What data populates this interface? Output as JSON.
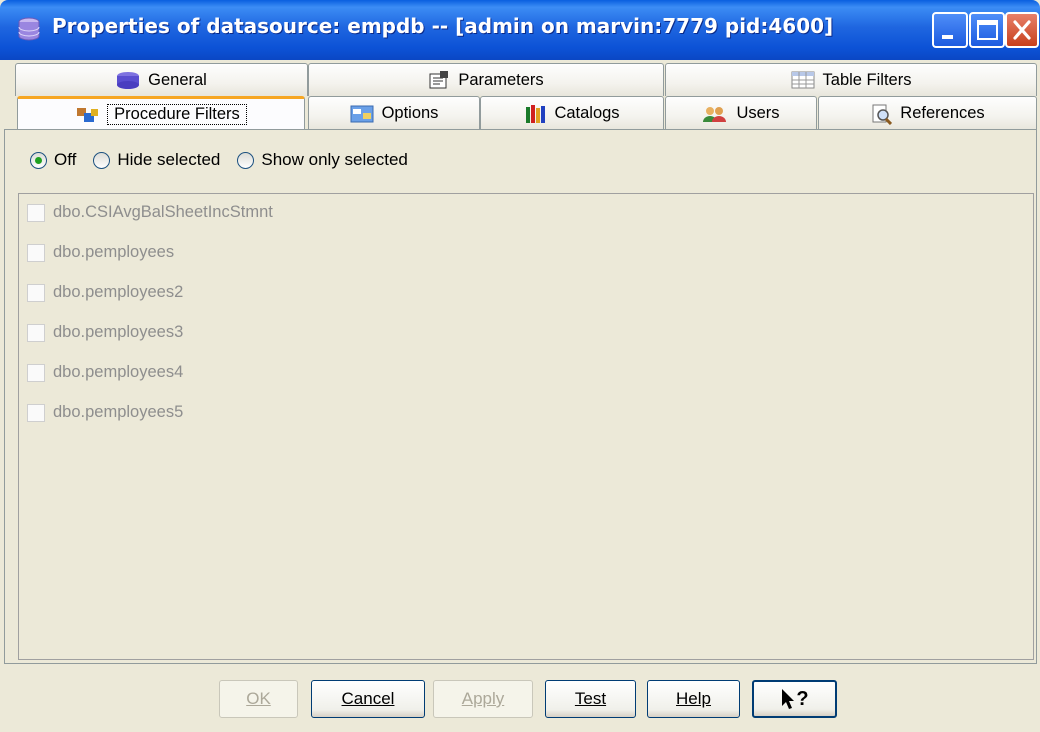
{
  "window": {
    "title": "Properties of datasource: empdb -- [admin on marvin:7779 pid:4600]",
    "icon": "database-icon"
  },
  "tabs": {
    "row1": [
      {
        "label": "General",
        "icon": "database-icon"
      },
      {
        "label": "Parameters",
        "icon": "parameters-icon"
      },
      {
        "label": "Table Filters",
        "icon": "table-icon"
      }
    ],
    "row2": [
      {
        "label": "Procedure Filters",
        "icon": "procedure-icon",
        "active": true
      },
      {
        "label": "Options",
        "icon": "options-icon"
      },
      {
        "label": "Catalogs",
        "icon": "books-icon"
      },
      {
        "label": "Users",
        "icon": "users-icon"
      },
      {
        "label": "References",
        "icon": "references-icon"
      }
    ]
  },
  "filter_mode": {
    "options": [
      "Off",
      "Hide selected",
      "Show only selected"
    ],
    "selected": "Off"
  },
  "procedures": [
    {
      "name": "dbo.CSIAvgBalSheetIncStmnt",
      "checked": false
    },
    {
      "name": "dbo.pemployees",
      "checked": false
    },
    {
      "name": "dbo.pemployees2",
      "checked": false
    },
    {
      "name": "dbo.pemployees3",
      "checked": false
    },
    {
      "name": "dbo.pemployees4",
      "checked": false
    },
    {
      "name": "dbo.pemployees5",
      "checked": false
    }
  ],
  "buttons": {
    "ok": {
      "label": "OK",
      "enabled": false
    },
    "cancel": {
      "label": "Cancel",
      "enabled": true
    },
    "apply": {
      "label": "Apply",
      "enabled": false
    },
    "test": {
      "label": "Test",
      "enabled": true
    },
    "help": {
      "label": "Help",
      "enabled": true
    },
    "context_help": {
      "label": "?",
      "icon": "whats-this-icon"
    }
  },
  "colors": {
    "titlebar": "#0c52d6",
    "dialog_bg": "#ece9d8",
    "active_tab_accent": "#f6a623",
    "disabled_text": "#8e8e8e"
  }
}
